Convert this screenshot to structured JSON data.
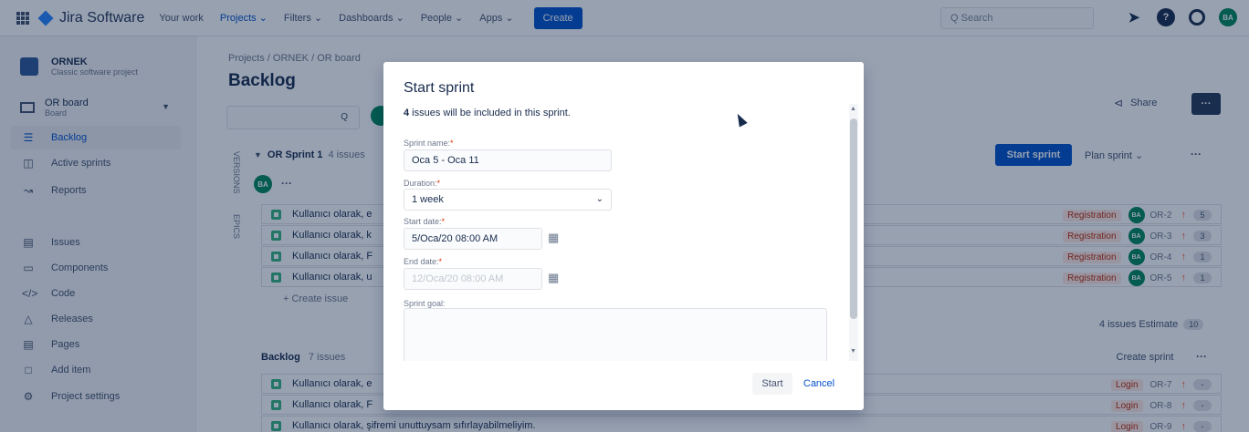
{
  "topnav": {
    "product": "Jira Software",
    "items": [
      "Your work",
      "Projects ⌄",
      "Filters ⌄",
      "Dashboards ⌄",
      "People ⌄",
      "Apps ⌄"
    ],
    "create_label": "Create",
    "search_placeholder": "Q  Search",
    "avatar_initials": "BA",
    "accent": "#0052cc"
  },
  "sidebar": {
    "project_name": "ORNEK",
    "project_type": "Classic software project",
    "board_name": "OR board",
    "board_sub": "Board",
    "items": [
      {
        "label": "Backlog",
        "icon": "backlog-icon"
      },
      {
        "label": "Active sprints",
        "icon": "board-columns-icon"
      },
      {
        "label": "Reports",
        "icon": "chart-icon"
      },
      {
        "label": "Issues",
        "icon": "issues-icon"
      },
      {
        "label": "Components",
        "icon": "component-icon"
      },
      {
        "label": "Code",
        "icon": "code-icon"
      },
      {
        "label": "Releases",
        "icon": "ship-icon"
      },
      {
        "label": "Pages",
        "icon": "page-icon"
      },
      {
        "label": "Add item",
        "icon": "add-item-icon"
      },
      {
        "label": "Project settings",
        "icon": "gear-icon"
      }
    ]
  },
  "main": {
    "breadcrumb": "Projects  /  ORNEK  /  OR board",
    "title": "Backlog",
    "share_label": "Share",
    "more_label": "···",
    "vtabs": [
      "VERSIONS",
      "EPICS"
    ],
    "sprint": {
      "name": "OR Sprint 1",
      "count": "4 issues",
      "avatar": "BA",
      "start_label": "Start sprint",
      "plan_label": "Plan sprint  ⌄",
      "issues": [
        {
          "summary": "Kullanıcı olarak, e",
          "label": "Registration",
          "key": "OR-2",
          "est": "5"
        },
        {
          "summary": "Kullanıcı olarak, k",
          "label": "Registration",
          "key": "OR-3",
          "est": "3"
        },
        {
          "summary": "Kullanıcı olarak, F",
          "label": "Registration",
          "key": "OR-4",
          "est": "1"
        },
        {
          "summary": "Kullanıcı olarak, u",
          "label": "Registration",
          "key": "OR-5",
          "est": "1"
        }
      ],
      "create_issue": "+  Create issue",
      "estimate_text": "4 issues  Estimate",
      "estimate_value": "10"
    },
    "backlog": {
      "name": "Backlog",
      "count": "7 issues",
      "create_sprint": "Create sprint",
      "issues": [
        {
          "summary": "Kullanıcı olarak, e",
          "label": "Login",
          "key": "OR-7",
          "est": "-"
        },
        {
          "summary": "Kullanıcı olarak, F",
          "label": "Login",
          "key": "OR-8",
          "est": "-"
        },
        {
          "summary": "Kullanıcı olarak, şifremi unuttuysam sıfırlayabilmeliyim.",
          "label": "Login",
          "key": "OR-9",
          "est": "-"
        }
      ]
    }
  },
  "modal": {
    "title": "Start sprint",
    "info_bold": "4",
    "info_rest": " issues will be included in this sprint.",
    "sprint_name_label": "Sprint name:",
    "sprint_name_value": "Oca 5 - Oca 11",
    "duration_label": "Duration:",
    "duration_value": "1 week",
    "start_date_label": "Start date:",
    "start_date_value": "5/Oca/20 08:00 AM",
    "end_date_label": "End date:",
    "end_date_value": "12/Oca/20 08:00 AM",
    "goal_label": "Sprint goal:",
    "start_button": "Start",
    "cancel_button": "Cancel",
    "required_mark": "*"
  }
}
